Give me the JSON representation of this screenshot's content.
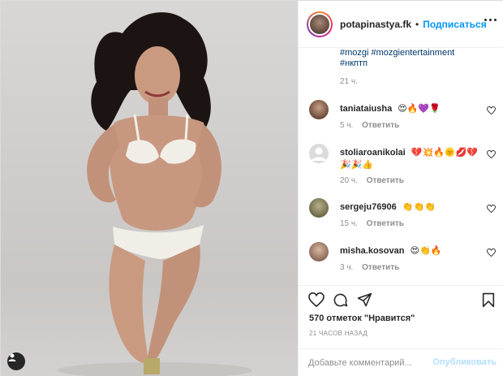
{
  "header": {
    "username": "potapinastya.fk",
    "separator": "•",
    "follow_label": "Подписаться",
    "more_icon": "more-horizontal-icon"
  },
  "caption": {
    "hashtag_line_1": "#mozgi #mozgientertainment",
    "hashtag_line_2": "#нкптп",
    "time": "21 ч."
  },
  "comments": [
    {
      "username": "taniataiusha",
      "text": "😍🔥💜🌹",
      "time": "5 ч.",
      "reply": "Ответить",
      "avatar_color": "#6b4a3a"
    },
    {
      "username": "stoliaroanikolai",
      "text": "💔💥🔥🌞💋💔 🎉🎉👍",
      "time": "20 ч.",
      "reply": "Ответить",
      "avatar_color": "#c7c7c7"
    },
    {
      "username": "sergeju76906",
      "text": "👏👏👏",
      "time": "15 ч.",
      "reply": "Ответить",
      "avatar_color": "#8a7a5a"
    },
    {
      "username": "misha.kosovan",
      "text": "😍👏🔥",
      "time": "3 ч.",
      "reply": "Ответить",
      "avatar_color": "#9a7a6a"
    }
  ],
  "actions": {
    "likes": "570 отметок \"Нравится\"",
    "posted": "21 часов назад"
  },
  "add_comment": {
    "placeholder": "Добавьте комментарий...",
    "post_label": "Опубликовать"
  },
  "colors": {
    "link": "#0095f6",
    "hashtag": "#00376b",
    "muted": "#8e8e8e"
  }
}
